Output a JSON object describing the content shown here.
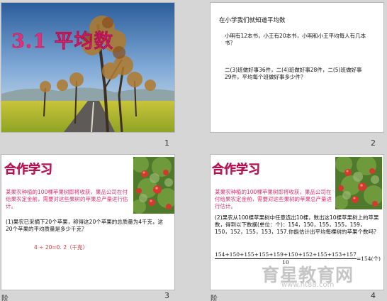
{
  "slides": [
    {
      "number": "1",
      "title": "3.1 平均数"
    },
    {
      "number": "2",
      "heading": "在小学我们就知道平均数",
      "q1": "小明有12本书，小王有20本书，小明和小王平均每人有几本书？",
      "q2": "二(3)班做好事36件，二(4)班做好事28件，二(5)班做好事29件，平均每个班做好事多少件？"
    },
    {
      "number": "3",
      "title": "合作学习",
      "intro": "某果农种植的100棵苹果树即将收获，果品公司在付给果农定金前，需要对这些果树的苹果总产量进行估计。",
      "q": "(1)果农已采摘下20个苹果，称得这20个苹果的总质量为4千克，这20个苹果的平均质量是多少千克？",
      "answer": "4 ÷ 20=0. 2（千克）",
      "footer": "阶"
    },
    {
      "number": "4",
      "title": "合作学习",
      "intro": "某果农种植的100棵苹果树即将收获，果品公司在付给果农定金前，需要对这些果树的苹果总产量进行估计。",
      "q": "(2)果农从100棵苹果树中任意选出10棵，数出这10棵苹果树上的苹果数，得到以下数据(单位：个)：154，150，155，155，159，150，152，155，153，157.你能估计出平均每棵树的苹果个数吗？",
      "numerator": "154+150+155+155+159+150+152+155+153+157",
      "denominator": "10",
      "result": "=154(个)",
      "footer": "阶",
      "watermark_cn": "育星教育网",
      "watermark_url": "www.ht88.com"
    }
  ],
  "colors": {
    "title_pink": "#e0307a",
    "text_pink": "#e0306e",
    "answer_red": "#e03030"
  }
}
